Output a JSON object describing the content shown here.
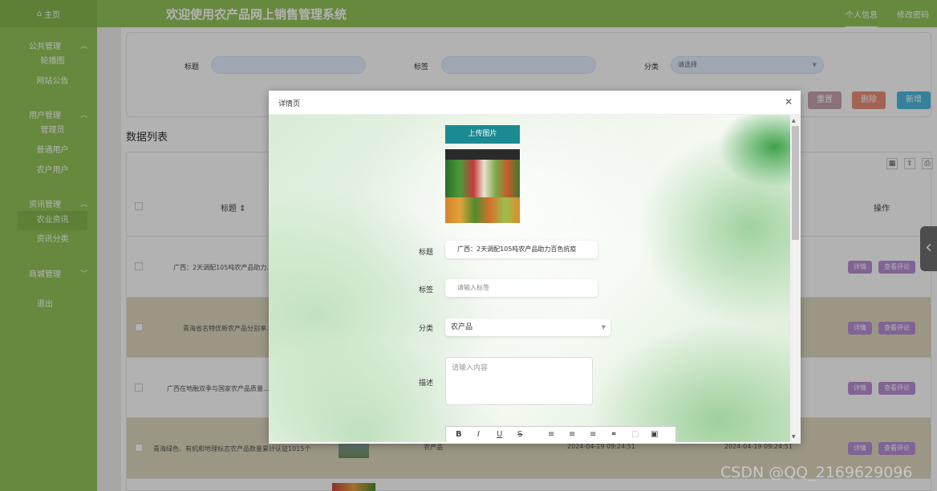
{
  "topbar": {
    "home_icon": "home-icon",
    "home_label": "主页",
    "title": "欢迎使用农产品网上销售管理系统",
    "profile_link": "个人信息",
    "change_password_link": "修改密码"
  },
  "sidebar": {
    "groups": [
      {
        "label": "公共管理",
        "items": [
          "轮播图",
          "网站公告"
        ]
      },
      {
        "label": "用户管理",
        "items": [
          "管理员",
          "普通用户",
          "农户用户"
        ]
      },
      {
        "label": "资讯管理",
        "items": [
          "农业资讯",
          "资讯分类"
        ]
      },
      {
        "label": "商城管理",
        "items": []
      }
    ],
    "active_item": "农业资讯",
    "logout": "退出"
  },
  "filter": {
    "title_label": "标题",
    "tag_label": "标签",
    "category_label": "分类",
    "category_placeholder": "请选择",
    "reset": "重置",
    "delete": "删除",
    "add": "新增"
  },
  "list": {
    "title": "数据列表",
    "headers": {
      "title": "标题",
      "actions": "操作"
    },
    "rows": [
      {
        "title": "广西：2天调配105吨农产品助力...",
        "category": "",
        "date": ""
      },
      {
        "title": "青海省名特优新农产品分别享...",
        "category": "",
        "date": ""
      },
      {
        "title": "广西在地融双季与国家农产品质量...",
        "category": "",
        "date": ""
      },
      {
        "title": "青海绿色、有机和地理标志农产品数量累计认证1015个",
        "category": "农产品",
        "date": "2024-04-19 09:24:51",
        "date2": "2024-04-19 09:24:51"
      }
    ],
    "detail_btn": "详情",
    "comments_btn": "查看评论"
  },
  "modal": {
    "title": "详情页",
    "upload_button": "上传图片",
    "title_label": "标题",
    "title_value": "广西：2天调配105吨农产品助力百色抗疫",
    "tag_label": "标签",
    "tag_placeholder": "请输入标签",
    "category_label": "分类",
    "category_value": "农产品",
    "desc_label": "描述",
    "desc_placeholder": "请输入内容"
  },
  "watermark": "CSDN @QQ_2169629096",
  "colors": {
    "primary": "#94c45a",
    "overlay": "rgba(0,0,0,0.30)",
    "purple_btn": "#b98fd6",
    "teal_btn": "#1b8a93"
  }
}
